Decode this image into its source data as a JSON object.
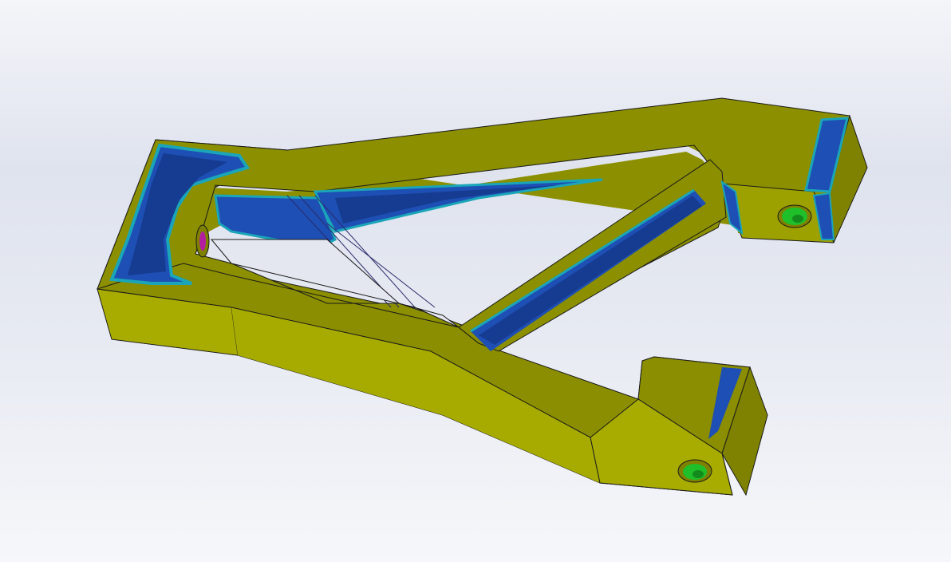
{
  "app": {
    "view": "graphics-area",
    "background_top": "#f4f5f9",
    "background_mid": "#dfe3ee",
    "background_bottom": "#f6f7fa"
  },
  "model": {
    "part": "a-arm",
    "plot": "fringe",
    "colors": {
      "base": "#a6aa00",
      "side_light": "#b2b500",
      "side_dark": "#7f8200",
      "top": "#8f9300",
      "low_band_blue": "#1e4fb4",
      "low_band_dark": "#163c91",
      "edge_cyan": "#1aa5b8",
      "hole_green": "#1fbf2a",
      "hole_magenta": "#b31ea0",
      "edge_line": "#1a1a1a"
    },
    "icons": {
      "hole_right": "mounting-hole-icon",
      "hole_bottom": "mounting-hole-icon",
      "hole_left": "pivot-hole-icon"
    }
  }
}
